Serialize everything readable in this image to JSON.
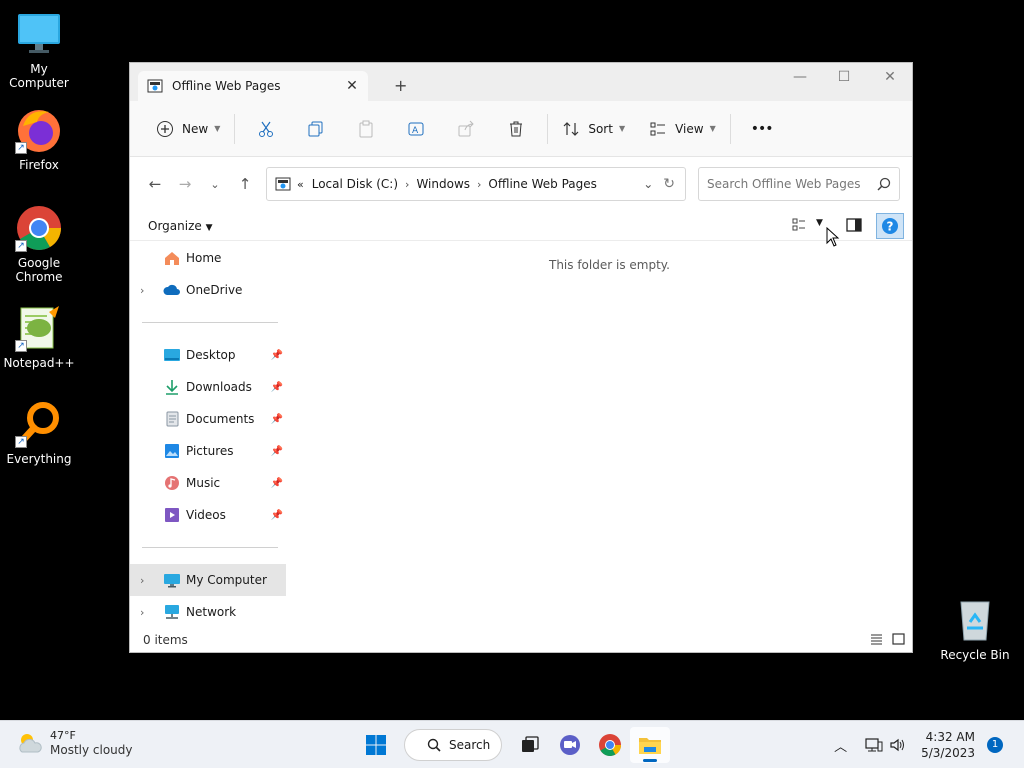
{
  "desktop": {
    "icons": [
      {
        "label": "My Computer"
      },
      {
        "label": "Firefox"
      },
      {
        "label": "Google Chrome"
      },
      {
        "label": "Notepad++"
      },
      {
        "label": "Everything"
      },
      {
        "label": "Recycle Bin"
      }
    ]
  },
  "window": {
    "tab_title": "Offline Web Pages",
    "toolbar": {
      "new_label": "New",
      "sort_label": "Sort",
      "view_label": "View",
      "more_label": "•••"
    },
    "address": {
      "overflow": "«",
      "crumbs": [
        "Local Disk (C:)",
        "Windows",
        "Offline Web Pages"
      ]
    },
    "search_placeholder": "Search Offline Web Pages",
    "organize_label": "Organize",
    "nav": {
      "top": [
        "Home",
        "OneDrive"
      ],
      "quick": [
        "Desktop",
        "Downloads",
        "Documents",
        "Pictures",
        "Music",
        "Videos"
      ],
      "bottom": [
        "My Computer",
        "Network"
      ]
    },
    "empty_message": "This folder is empty.",
    "status": "0 items"
  },
  "taskbar": {
    "weather_temp": "47°F",
    "weather_cond": "Mostly cloudy",
    "search_label": "Search",
    "time": "4:32 AM",
    "date": "5/3/2023",
    "notification_count": "1"
  },
  "colors": {
    "accent": "#0067c0",
    "folder": "#f3c13a"
  }
}
